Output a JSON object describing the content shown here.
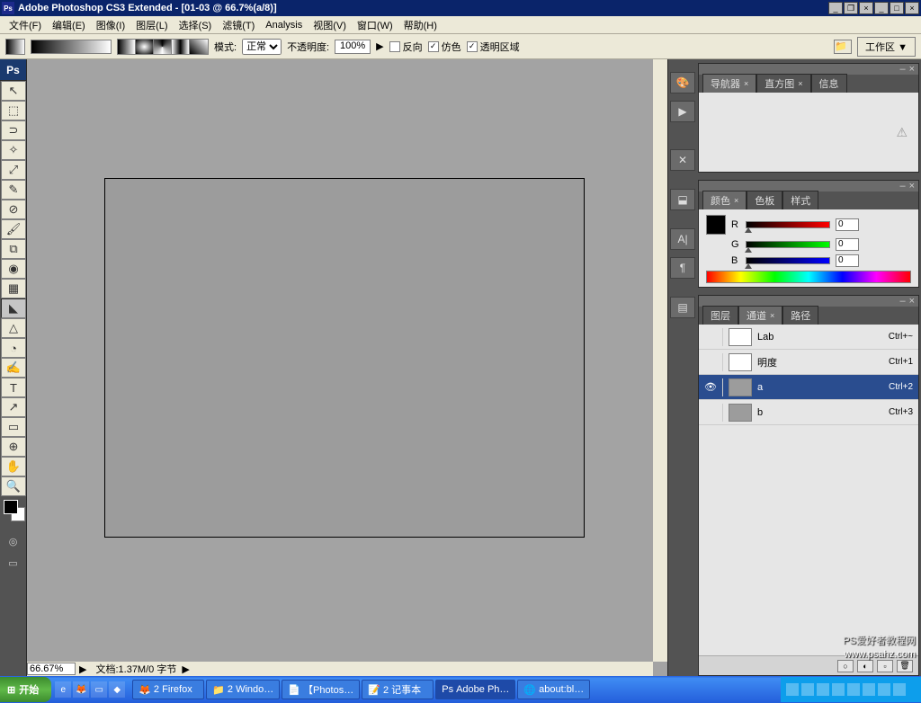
{
  "titlebar": {
    "app_icon": "Ps",
    "title": "Adobe Photoshop CS3 Extended - [01-03 @ 66.7%(a/8)]"
  },
  "menubar": {
    "items": [
      "文件(F)",
      "编辑(E)",
      "图像(I)",
      "图层(L)",
      "选择(S)",
      "滤镜(T)",
      "Analysis",
      "视图(V)",
      "窗口(W)",
      "帮助(H)"
    ]
  },
  "optionsbar": {
    "mode_label": "模式:",
    "mode_value": "正常",
    "opacity_label": "不透明度:",
    "opacity_value": "100%",
    "reverse_label": "反向",
    "dither_label": "仿色",
    "transparent_label": "透明区域",
    "workspace_label": "工作区 ▼"
  },
  "tools": [
    "↖",
    "⬚",
    "⊃",
    "✧",
    "⤢",
    "✎",
    "⊘",
    "🖌",
    "⧉",
    "◉",
    "▦",
    "◣",
    "△",
    "◔",
    "✍",
    "T",
    "↗",
    "▭",
    "⊕",
    "✋",
    "🔍"
  ],
  "canvas": {
    "zoom": "66.67%",
    "doc_info": "文档:1.37M/0 字节"
  },
  "panels": {
    "navigator": {
      "tabs": [
        "导航器",
        "直方图",
        "信息"
      ],
      "active": 0
    },
    "color": {
      "tabs": [
        "颜色",
        "色板",
        "样式"
      ],
      "active": 0,
      "r": {
        "label": "R",
        "value": "0"
      },
      "g": {
        "label": "G",
        "value": "0"
      },
      "b": {
        "label": "B",
        "value": "0"
      }
    },
    "channels": {
      "tabs": [
        "图层",
        "通道",
        "路径"
      ],
      "active": 1,
      "rows": [
        {
          "name": "Lab",
          "shortcut": "Ctrl+~",
          "white": true,
          "eye": false
        },
        {
          "name": "明度",
          "shortcut": "Ctrl+1",
          "white": true,
          "eye": false
        },
        {
          "name": "a",
          "shortcut": "Ctrl+2",
          "white": false,
          "eye": true,
          "selected": true
        },
        {
          "name": "b",
          "shortcut": "Ctrl+3",
          "white": false,
          "eye": false
        }
      ]
    }
  },
  "taskbar": {
    "start": "开始",
    "tasks": [
      "2 Firefox",
      "2 Windo…",
      "【Photos…",
      "2 记事本",
      "Adobe Ph…",
      "about:bl…"
    ],
    "clock": ""
  },
  "watermark": {
    "line1": "PS爱好者教程网",
    "line2": "www.psahz.com"
  }
}
